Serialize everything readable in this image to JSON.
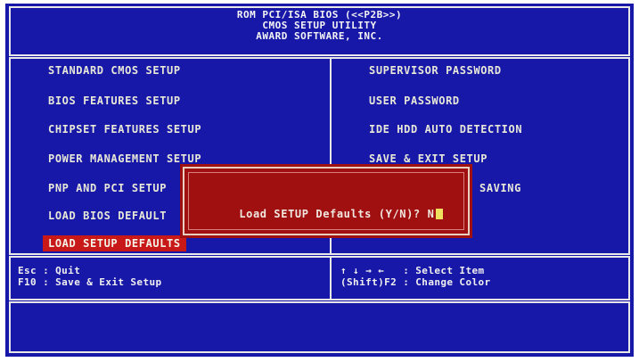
{
  "header": {
    "line1": "ROM PCI/ISA BIOS (<<P2B>>)",
    "line2": "CMOS SETUP UTILITY",
    "line3": "AWARD SOFTWARE, INC."
  },
  "menu_left": [
    "STANDARD CMOS SETUP",
    "BIOS FEATURES SETUP",
    "CHIPSET FEATURES SETUP",
    "POWER MANAGEMENT SETUP",
    "PNP AND PCI SETUP",
    "LOAD BIOS DEFAULT",
    "LOAD SETUP DEFAULTS"
  ],
  "menu_right": [
    "SUPERVISOR PASSWORD",
    "USER PASSWORD",
    "IDE HDD AUTO DETECTION",
    "SAVE & EXIT SETUP",
    "SAVING"
  ],
  "selected_item": "LOAD SETUP DEFAULTS",
  "dialog": {
    "prompt": "Load SETUP Defaults (Y/N)? N"
  },
  "footer": {
    "left_line1": "Esc : Quit",
    "left_line2": "F10 : Save & Exit Setup",
    "right_line1": "↑ ↓ → ←   : Select Item",
    "right_line2": "(Shift)F2 : Change Color"
  },
  "colors": {
    "background": "#1818a8",
    "selected": "#c81818",
    "dialog": "#a01010",
    "text": "#e8e8d8"
  }
}
